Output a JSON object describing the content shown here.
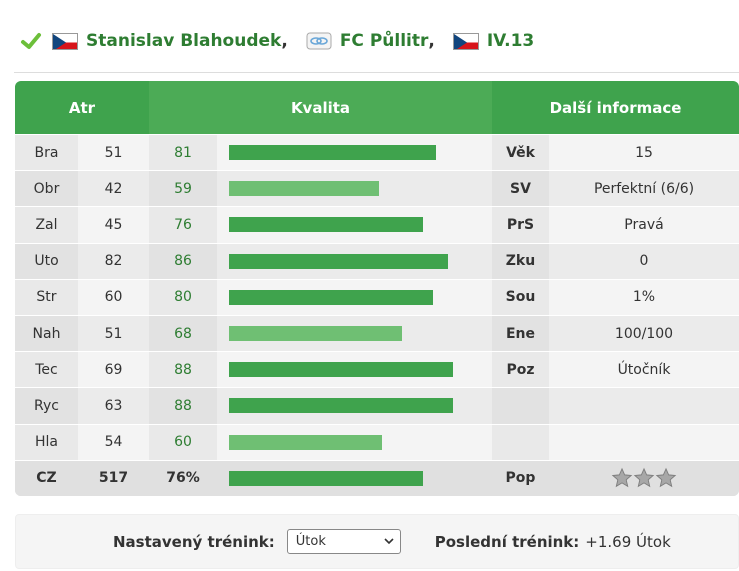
{
  "header": {
    "player_name": "Stanislav Blahoudek",
    "team_name": "FC Půllitr",
    "league": "IV.13",
    "separator": ","
  },
  "table": {
    "col_atr": "Atr",
    "col_kvalita": "Kvalita",
    "col_info": "Další informace",
    "rows": [
      {
        "name": "Bra",
        "value": "51",
        "quality": "81",
        "bar": 0.81,
        "key": "Věk",
        "info": "15"
      },
      {
        "name": "Obr",
        "value": "42",
        "quality": "59",
        "bar": 0.59,
        "key": "SV",
        "info": "Perfektní (6/6)"
      },
      {
        "name": "Zal",
        "value": "45",
        "quality": "76",
        "bar": 0.76,
        "key": "PrS",
        "info": "Pravá"
      },
      {
        "name": "Uto",
        "value": "82",
        "quality": "86",
        "bar": 0.86,
        "key": "Zku",
        "info": "0"
      },
      {
        "name": "Str",
        "value": "60",
        "quality": "80",
        "bar": 0.8,
        "key": "Sou",
        "info": "1%"
      },
      {
        "name": "Nah",
        "value": "51",
        "quality": "68",
        "bar": 0.68,
        "key": "Ene",
        "info": "100/100"
      },
      {
        "name": "Tec",
        "value": "69",
        "quality": "88",
        "bar": 0.88,
        "key": "Poz",
        "info": "Útočník"
      },
      {
        "name": "Ryc",
        "value": "63",
        "quality": "88",
        "bar": 0.88,
        "key": "",
        "info": ""
      },
      {
        "name": "Hla",
        "value": "54",
        "quality": "60",
        "bar": 0.6,
        "key": "",
        "info": ""
      }
    ],
    "total": {
      "name": "CZ",
      "value": "517",
      "quality": "76%",
      "bar": 0.76,
      "key": "Pop",
      "stars": 3
    }
  },
  "training": {
    "label": "Nastavený trénink:",
    "selected": "Útok",
    "last_label": "Poslední trénink:",
    "last_value": "+1.69 Útok"
  },
  "colors": {
    "bar_strong": "#3fa34d",
    "bar_light": "#6fbf73",
    "header_green": "#3fa34d",
    "link_green": "#2e7d32"
  }
}
